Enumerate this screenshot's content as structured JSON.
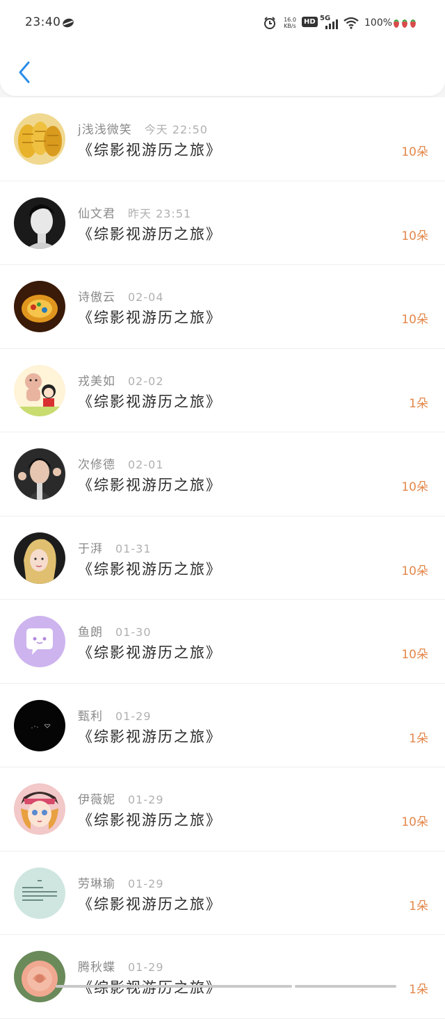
{
  "status_bar": {
    "time": "23:40",
    "net_speed_top": "16.0",
    "net_speed_bottom": "KB/s",
    "hd": "HD",
    "network": "5G",
    "battery": "100%"
  },
  "colors": {
    "accent": "#2a8de8",
    "count": "#e3874a"
  },
  "items": [
    {
      "name": "j浅浅微笑",
      "date": "今天 22:50",
      "title": "《综影视游历之旅》",
      "count": "10朵",
      "avatar_icon": "pineapple-avatar"
    },
    {
      "name": "仙文君",
      "date": "昨天 23:51",
      "title": "《综影视游历之旅》",
      "count": "10朵",
      "avatar_icon": "bw-portrait-avatar"
    },
    {
      "name": "诗傲云",
      "date": "02-04",
      "title": "《综影视游历之旅》",
      "count": "10朵",
      "avatar_icon": "lantern-avatar"
    },
    {
      "name": "戎美如",
      "date": "02-02",
      "title": "《综影视游历之旅》",
      "count": "1朵",
      "avatar_icon": "cartoon-avatar"
    },
    {
      "name": "次修德",
      "date": "02-01",
      "title": "《综影视游历之旅》",
      "count": "10朵",
      "avatar_icon": "boy-portrait-avatar"
    },
    {
      "name": "于湃",
      "date": "01-31",
      "title": "《综影视游历之旅》",
      "count": "10朵",
      "avatar_icon": "girl-portrait-avatar"
    },
    {
      "name": "鱼朗",
      "date": "01-30",
      "title": "《综影视游历之旅》",
      "count": "10朵",
      "avatar_icon": "chat-bubble-avatar"
    },
    {
      "name": "甄利",
      "date": "01-29",
      "title": "《综影视游历之旅》",
      "count": "1朵",
      "avatar_icon": "black-avatar"
    },
    {
      "name": "伊薇妮",
      "date": "01-29",
      "title": "《综影视游历之旅》",
      "count": "10朵",
      "avatar_icon": "doll-avatar"
    },
    {
      "name": "劳琳瑜",
      "date": "01-29",
      "title": "《综影视游历之旅》",
      "count": "1朵",
      "avatar_icon": "text-card-avatar"
    },
    {
      "name": "腾秋蝶",
      "date": "01-29",
      "title": "《综影视游历之旅》",
      "count": "1朵",
      "avatar_icon": "rose-avatar"
    }
  ]
}
